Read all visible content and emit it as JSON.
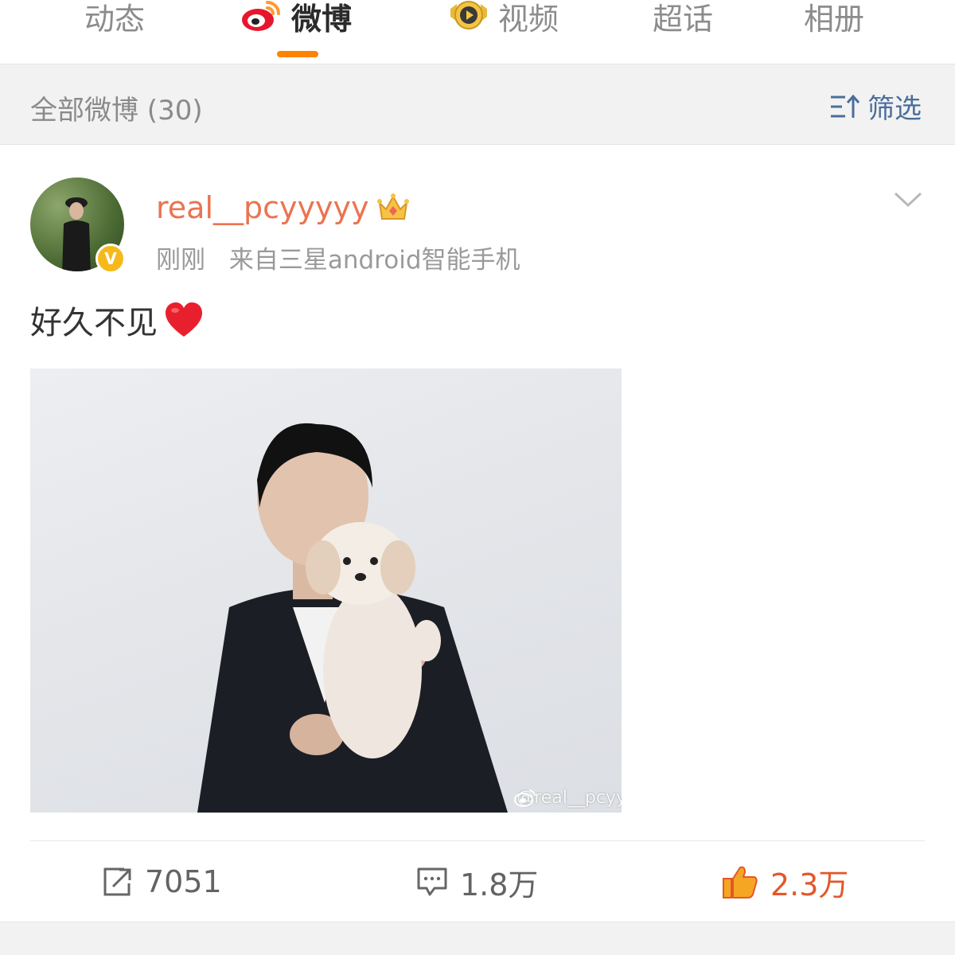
{
  "tabs": [
    {
      "label": "动态",
      "icon": "none",
      "active": false
    },
    {
      "label": "微博",
      "icon": "weibo-logo-icon",
      "active": true
    },
    {
      "label": "视频",
      "icon": "video-badge-icon",
      "active": false
    },
    {
      "label": "超话",
      "icon": "none",
      "active": false
    },
    {
      "label": "相册",
      "icon": "none",
      "active": false
    }
  ],
  "filter": {
    "title": "全部微博 (30)",
    "button_label": "筛选",
    "button_icon": "filter-sort-icon"
  },
  "post": {
    "username": "real__pcyyyyy",
    "user_badge_icon": "crown-icon",
    "verified_mark": "V",
    "time": "刚刚",
    "source": "来自三星android智能手机",
    "text": "好久不见",
    "emoji_icon": "red-heart-icon",
    "image_watermark": "@real__pcyy",
    "actions": {
      "repost": "7051",
      "comment": "1.8万",
      "like": "2.3万"
    }
  },
  "colors": {
    "accent": "#ff8200",
    "username": "#eb7350",
    "link_blue": "#4a6e9a",
    "like_active": "#e3572a",
    "muted_text": "#9a9a9a",
    "background_gray": "#f2f2f2"
  }
}
